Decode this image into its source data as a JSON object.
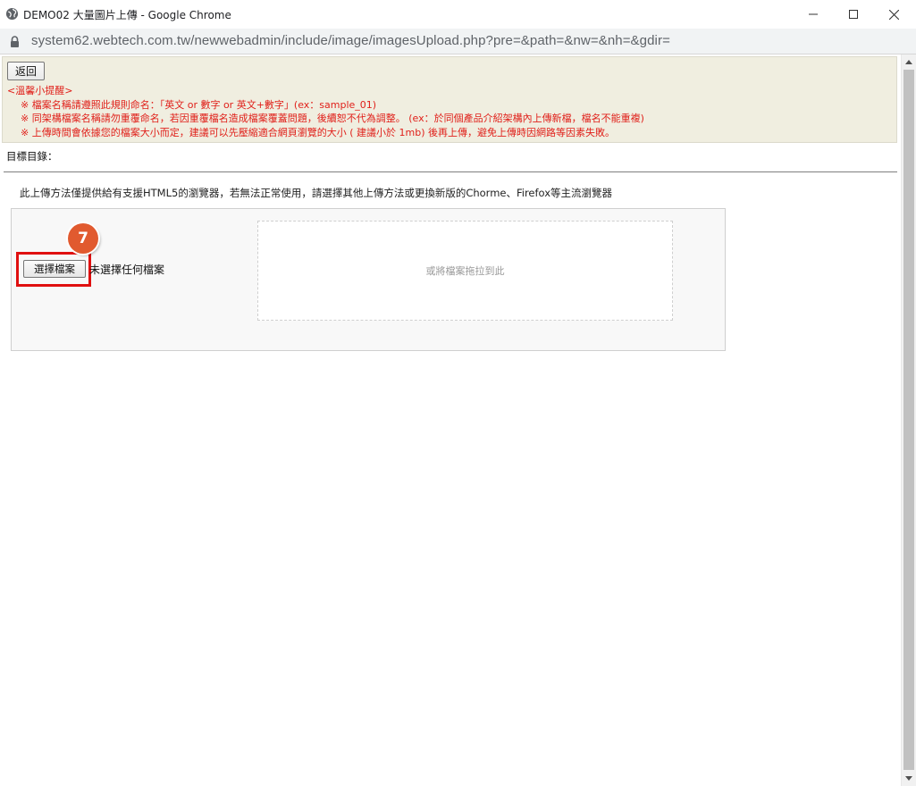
{
  "window": {
    "title": "DEMO02 大量圖片上傳 - Google Chrome"
  },
  "addressbar": {
    "url": "system62.webtech.com.tw/newwebadmin/include/image/imagesUpload.php?pre=&path=&nw=&nh=&gdir="
  },
  "page": {
    "back_button": "返回",
    "tips": {
      "heading": "<溫馨小提醒>",
      "lines": [
        "※ 檔案名稱請遵照此規則命名：「英文 or 數字 or 英文+數字」(ex：sample_01)",
        "※ 同架構檔案名稱請勿重覆命名，若因重覆檔名造成檔案覆蓋問題，後續恕不代為調整。 (ex：於同個產品介紹架構內上傳新檔，檔名不能重複)",
        "※ 上傳時間會依據您的檔案大小而定，建議可以先壓縮適合網頁瀏覽的大小 ( 建議小於 1mb) 後再上傳，避免上傳時因網路等因素失敗。"
      ]
    },
    "target_dir_label": "目標目錄：",
    "html5_note": "此上傳方法僅提供給有支援HTML5的瀏覽器，若無法正常使用，請選擇其他上傳方法或更換新版的Chorme、Firefox等主流瀏覽器",
    "upload": {
      "choose_button": "選擇檔案",
      "no_file_text": "未選擇任何檔案",
      "dropzone_text": "或將檔案拖拉到此"
    },
    "step_badge": "7"
  },
  "colors": {
    "notice_bg": "#f0eee0",
    "tips_text": "#e0201a",
    "highlight": "#e01010",
    "badge": "#e15a2f"
  },
  "icons": [
    "globe-icon",
    "minimize-icon",
    "maximize-icon",
    "close-icon",
    "lock-icon",
    "scroll-up-icon",
    "scroll-down-icon"
  ]
}
